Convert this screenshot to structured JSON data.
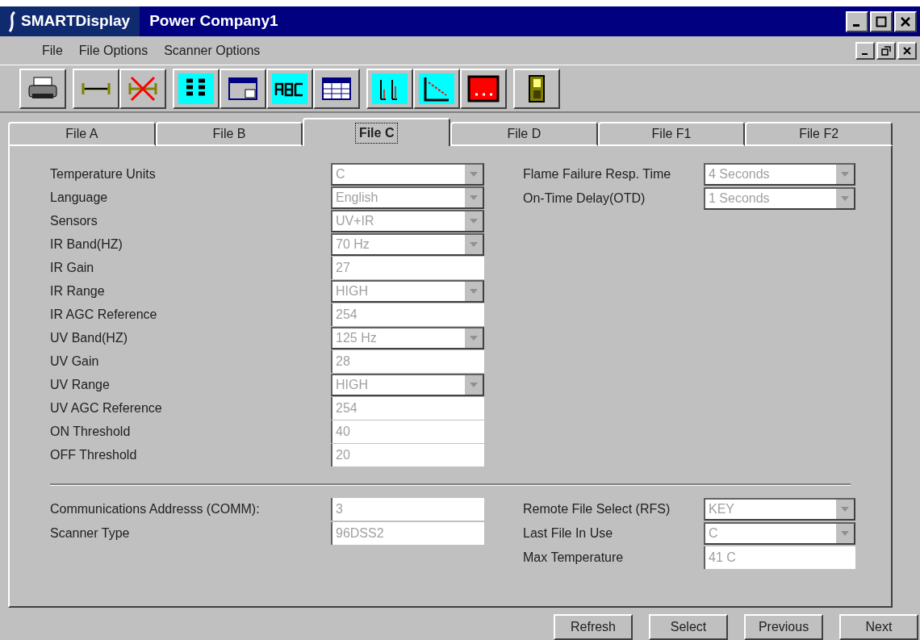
{
  "window": {
    "app_name": "SMARTDisplay",
    "title": "Power Company1"
  },
  "menu": [
    "File",
    "File Options",
    "Scanner Options"
  ],
  "tabs": [
    {
      "label": "File A",
      "selected": false
    },
    {
      "label": "File B",
      "selected": false
    },
    {
      "label": "File C",
      "selected": true
    },
    {
      "label": "File D",
      "selected": false
    },
    {
      "label": "File F1",
      "selected": false
    },
    {
      "label": "File F2",
      "selected": false
    }
  ],
  "left_fields": [
    {
      "label": "Temperature Units",
      "value": "C",
      "kind": "select",
      "disabled": true
    },
    {
      "label": "Language",
      "value": "English",
      "kind": "select",
      "disabled": true
    },
    {
      "label": "Sensors",
      "value": "UV+IR",
      "kind": "select",
      "disabled": true
    },
    {
      "label": "IR Band(HZ)",
      "value": "70 Hz",
      "kind": "select",
      "disabled": true
    },
    {
      "label": "IR Gain",
      "value": "27",
      "kind": "text",
      "disabled": true
    },
    {
      "label": "IR Range",
      "value": "HIGH",
      "kind": "select",
      "disabled": true
    },
    {
      "label": "IR AGC Reference",
      "value": "254",
      "kind": "text",
      "disabled": true
    },
    {
      "label": "UV Band(HZ)",
      "value": "125 Hz",
      "kind": "select",
      "disabled": true
    },
    {
      "label": "UV Gain",
      "value": "28",
      "kind": "text",
      "disabled": true
    },
    {
      "label": "UV Range",
      "value": "HIGH",
      "kind": "select",
      "disabled": true
    },
    {
      "label": "UV AGC Reference",
      "value": "254",
      "kind": "text",
      "disabled": true
    },
    {
      "label": "ON Threshold",
      "value": "40",
      "kind": "text",
      "disabled": true
    },
    {
      "label": "OFF Threshold",
      "value": "20",
      "kind": "text",
      "disabled": true
    }
  ],
  "right_fields": [
    {
      "label": "Flame Failure Resp. Time",
      "value": "4 Seconds",
      "kind": "select",
      "disabled": true
    },
    {
      "label": "On-Time Delay(OTD)",
      "value": "1 Seconds",
      "kind": "select",
      "disabled": true
    }
  ],
  "bottom_left_fields": [
    {
      "label": "Communications Addresss (COMM):",
      "value": "3",
      "kind": "text",
      "disabled": true
    },
    {
      "label": "Scanner Type",
      "value": "96DSS2",
      "kind": "text",
      "disabled": true
    }
  ],
  "bottom_right_fields": [
    {
      "label": "Remote File Select (RFS)",
      "value": "KEY",
      "kind": "select",
      "disabled": true
    },
    {
      "label": "Last File In Use",
      "value": "C",
      "kind": "select",
      "disabled": true
    },
    {
      "label": "Max Temperature",
      "value": "41 C",
      "kind": "text",
      "disabled": true
    }
  ],
  "buttons": [
    "Refresh",
    "Select",
    "Previous",
    "Next"
  ]
}
